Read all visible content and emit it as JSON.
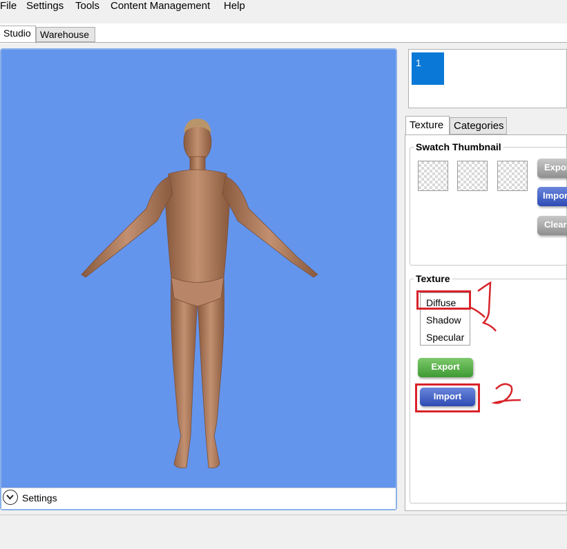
{
  "menu": [
    "File",
    "Settings",
    "Tools",
    "Content Management",
    "Help"
  ],
  "main_tabs": [
    "Studio",
    "Warehouse"
  ],
  "viewport": {
    "settings_label": "Settings"
  },
  "swatch_list": {
    "items": [
      "1"
    ]
  },
  "sub_tabs": [
    "Texture",
    "Categories"
  ],
  "swatch_thumbnail": {
    "title": "Swatch Thumbnail",
    "buttons": [
      "Expor",
      "Impor",
      "Clear"
    ]
  },
  "texture": {
    "title": "Texture",
    "options": [
      "Diffuse",
      "Shadow",
      "Specular"
    ],
    "selected": "Diffuse",
    "export_label": "Export",
    "import_label": "Import"
  },
  "annotations": {
    "mark_1": "1",
    "mark_2": "2"
  },
  "colors": {
    "viewport_bg": "#6495ed",
    "swatch_selected": "#0a78d7",
    "highlight_red": "#d8232a",
    "export_green": "#4fa93f",
    "import_blue": "#3e5cc4"
  }
}
